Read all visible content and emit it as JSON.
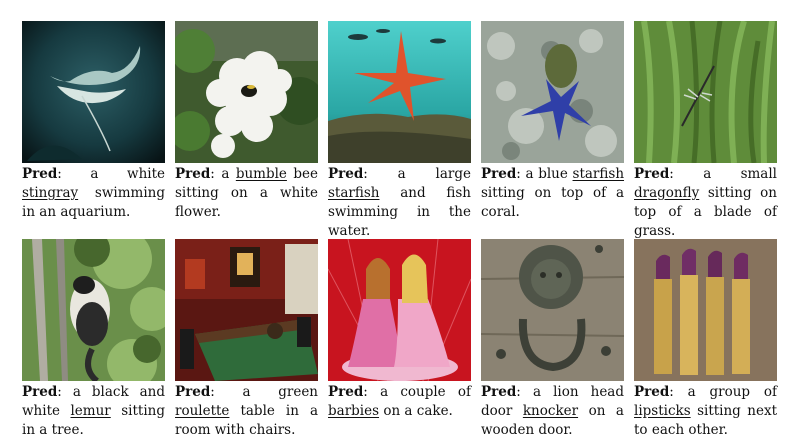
{
  "figure": {
    "pred_label": "Pred",
    "rows": [
      {
        "cells": [
          {
            "image": "stingray-aquarium-photo",
            "pre": "a white ",
            "obj": "stingray",
            "post": " swimming in an aquarium."
          },
          {
            "image": "bee-on-white-flower-photo",
            "pre": "a ",
            "obj": "bumble",
            "post": " bee sitting on a white flower."
          },
          {
            "image": "starfish-and-fish-underwater-photo",
            "pre": "a large ",
            "obj": "starfish",
            "post": " and fish swimming in the water."
          },
          {
            "image": "blue-starfish-on-coral-photo",
            "pre": "a blue ",
            "obj": "starfish",
            "post": " sitting on top of a coral."
          },
          {
            "image": "dragonfly-on-grass-photo",
            "pre": "a small ",
            "obj": "dragonfly",
            "post": " sitting on top of a blade of grass."
          }
        ]
      },
      {
        "cells": [
          {
            "image": "lemur-in-tree-photo",
            "pre": "a black and white ",
            "obj": "lemur",
            "post": " sitting in a tree."
          },
          {
            "image": "roulette-table-room-photo",
            "pre": "a green ",
            "obj": "roulette",
            "post": " table in a room with chairs."
          },
          {
            "image": "barbie-dolls-cake-photo",
            "pre": "a couple of ",
            "obj": "barbies",
            "post": " on a cake."
          },
          {
            "image": "lion-head-door-knocker-photo",
            "pre": "a lion head door ",
            "obj": "knocker",
            "post": " on a wooden door."
          },
          {
            "image": "lipsticks-row-photo",
            "pre": "a group of ",
            "obj": "lipsticks",
            "post": " sitting next to each other."
          }
        ]
      }
    ]
  }
}
